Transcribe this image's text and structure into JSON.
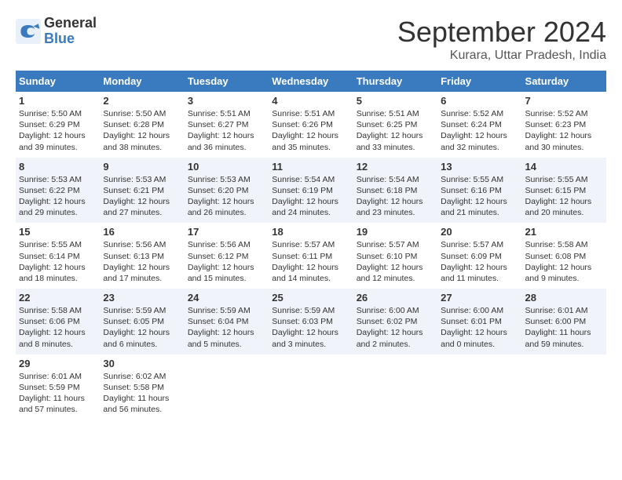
{
  "logo": {
    "general": "General",
    "blue": "Blue"
  },
  "title": "September 2024",
  "subtitle": "Kurara, Uttar Pradesh, India",
  "days_of_week": [
    "Sunday",
    "Monday",
    "Tuesday",
    "Wednesday",
    "Thursday",
    "Friday",
    "Saturday"
  ],
  "weeks": [
    [
      {
        "day": "1",
        "sunrise": "5:50 AM",
        "sunset": "6:29 PM",
        "daylight": "12 hours and 39 minutes."
      },
      {
        "day": "2",
        "sunrise": "5:50 AM",
        "sunset": "6:28 PM",
        "daylight": "12 hours and 38 minutes."
      },
      {
        "day": "3",
        "sunrise": "5:51 AM",
        "sunset": "6:27 PM",
        "daylight": "12 hours and 36 minutes."
      },
      {
        "day": "4",
        "sunrise": "5:51 AM",
        "sunset": "6:26 PM",
        "daylight": "12 hours and 35 minutes."
      },
      {
        "day": "5",
        "sunrise": "5:51 AM",
        "sunset": "6:25 PM",
        "daylight": "12 hours and 33 minutes."
      },
      {
        "day": "6",
        "sunrise": "5:52 AM",
        "sunset": "6:24 PM",
        "daylight": "12 hours and 32 minutes."
      },
      {
        "day": "7",
        "sunrise": "5:52 AM",
        "sunset": "6:23 PM",
        "daylight": "12 hours and 30 minutes."
      }
    ],
    [
      {
        "day": "8",
        "sunrise": "5:53 AM",
        "sunset": "6:22 PM",
        "daylight": "12 hours and 29 minutes."
      },
      {
        "day": "9",
        "sunrise": "5:53 AM",
        "sunset": "6:21 PM",
        "daylight": "12 hours and 27 minutes."
      },
      {
        "day": "10",
        "sunrise": "5:53 AM",
        "sunset": "6:20 PM",
        "daylight": "12 hours and 26 minutes."
      },
      {
        "day": "11",
        "sunrise": "5:54 AM",
        "sunset": "6:19 PM",
        "daylight": "12 hours and 24 minutes."
      },
      {
        "day": "12",
        "sunrise": "5:54 AM",
        "sunset": "6:18 PM",
        "daylight": "12 hours and 23 minutes."
      },
      {
        "day": "13",
        "sunrise": "5:55 AM",
        "sunset": "6:16 PM",
        "daylight": "12 hours and 21 minutes."
      },
      {
        "day": "14",
        "sunrise": "5:55 AM",
        "sunset": "6:15 PM",
        "daylight": "12 hours and 20 minutes."
      }
    ],
    [
      {
        "day": "15",
        "sunrise": "5:55 AM",
        "sunset": "6:14 PM",
        "daylight": "12 hours and 18 minutes."
      },
      {
        "day": "16",
        "sunrise": "5:56 AM",
        "sunset": "6:13 PM",
        "daylight": "12 hours and 17 minutes."
      },
      {
        "day": "17",
        "sunrise": "5:56 AM",
        "sunset": "6:12 PM",
        "daylight": "12 hours and 15 minutes."
      },
      {
        "day": "18",
        "sunrise": "5:57 AM",
        "sunset": "6:11 PM",
        "daylight": "12 hours and 14 minutes."
      },
      {
        "day": "19",
        "sunrise": "5:57 AM",
        "sunset": "6:10 PM",
        "daylight": "12 hours and 12 minutes."
      },
      {
        "day": "20",
        "sunrise": "5:57 AM",
        "sunset": "6:09 PM",
        "daylight": "12 hours and 11 minutes."
      },
      {
        "day": "21",
        "sunrise": "5:58 AM",
        "sunset": "6:08 PM",
        "daylight": "12 hours and 9 minutes."
      }
    ],
    [
      {
        "day": "22",
        "sunrise": "5:58 AM",
        "sunset": "6:06 PM",
        "daylight": "12 hours and 8 minutes."
      },
      {
        "day": "23",
        "sunrise": "5:59 AM",
        "sunset": "6:05 PM",
        "daylight": "12 hours and 6 minutes."
      },
      {
        "day": "24",
        "sunrise": "5:59 AM",
        "sunset": "6:04 PM",
        "daylight": "12 hours and 5 minutes."
      },
      {
        "day": "25",
        "sunrise": "5:59 AM",
        "sunset": "6:03 PM",
        "daylight": "12 hours and 3 minutes."
      },
      {
        "day": "26",
        "sunrise": "6:00 AM",
        "sunset": "6:02 PM",
        "daylight": "12 hours and 2 minutes."
      },
      {
        "day": "27",
        "sunrise": "6:00 AM",
        "sunset": "6:01 PM",
        "daylight": "12 hours and 0 minutes."
      },
      {
        "day": "28",
        "sunrise": "6:01 AM",
        "sunset": "6:00 PM",
        "daylight": "11 hours and 59 minutes."
      }
    ],
    [
      {
        "day": "29",
        "sunrise": "6:01 AM",
        "sunset": "5:59 PM",
        "daylight": "11 hours and 57 minutes."
      },
      {
        "day": "30",
        "sunrise": "6:02 AM",
        "sunset": "5:58 PM",
        "daylight": "11 hours and 56 minutes."
      },
      null,
      null,
      null,
      null,
      null
    ]
  ]
}
